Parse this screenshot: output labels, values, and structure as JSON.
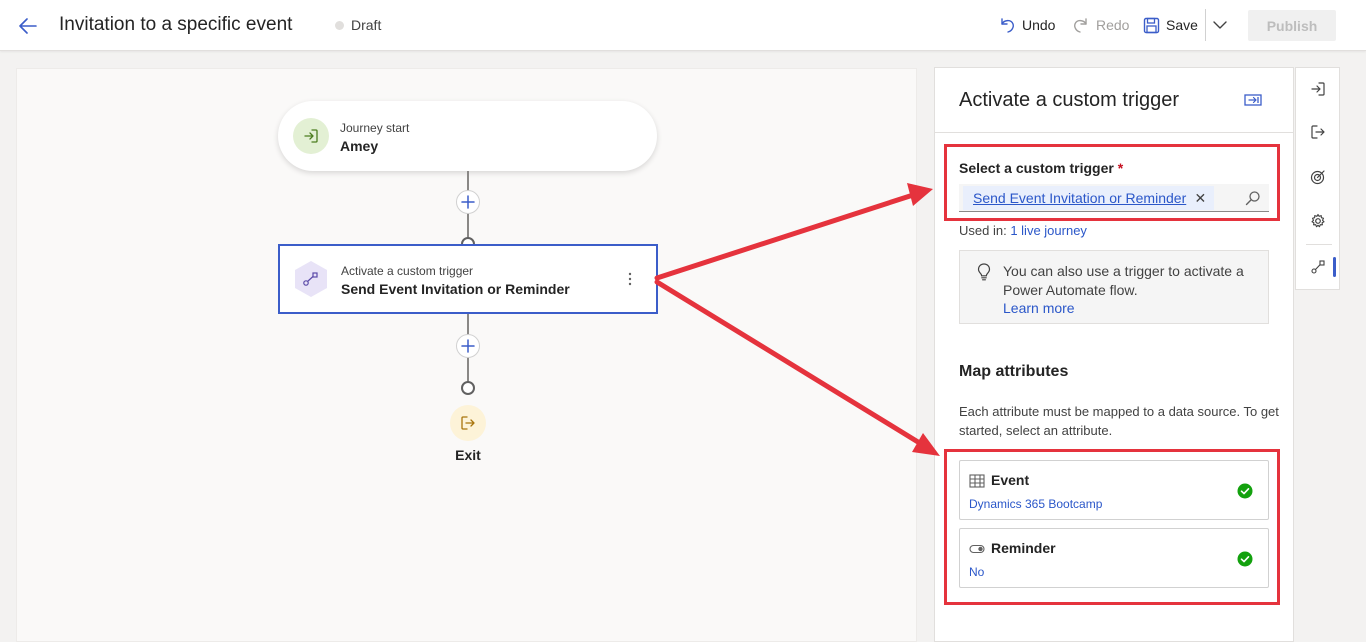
{
  "header": {
    "title": "Invitation to a specific event",
    "status": "Draft",
    "undo_label": "Undo",
    "redo_label": "Redo",
    "save_label": "Save",
    "publish_label": "Publish"
  },
  "canvas": {
    "start_node": {
      "subtitle": "Journey start",
      "title": "Amey"
    },
    "trigger_node": {
      "subtitle": "Activate a custom trigger",
      "title": "Send Event Invitation or Reminder"
    },
    "exit_node": {
      "title": "Exit"
    }
  },
  "panel": {
    "title": "Activate a custom trigger",
    "trigger_field": {
      "label": "Select a custom trigger",
      "required_mark": "*",
      "selected_value": "Send Event Invitation or Reminder",
      "remove_glyph": "✕"
    },
    "used_in": {
      "label": "Used in:",
      "link": "1 live journey"
    },
    "info": {
      "text": "You can also use a trigger to activate a Power Automate flow.",
      "link": "Learn more"
    },
    "map_attributes": {
      "title": "Map attributes",
      "description": "Each attribute must be mapped to a data source. To get started, select an attribute.",
      "items": [
        {
          "name": "Event",
          "value": "Dynamics 365 Bootcamp",
          "icon": "table-icon"
        },
        {
          "name": "Reminder",
          "value": "No",
          "icon": "toggle-icon"
        }
      ]
    }
  },
  "rail": {
    "items": [
      "enter-icon",
      "exit-icon",
      "target-icon",
      "gear-icon",
      "trigger-icon"
    ],
    "active": "trigger-icon"
  },
  "colors": {
    "accent": "#3b5dc9",
    "link": "#2b57c9",
    "annotation": "#e5333d",
    "success": "#13a10e",
    "start_bg": "#e3f0d4",
    "exit_bg": "#fdf3d8",
    "trigger_bg": "#e8e3f7"
  }
}
